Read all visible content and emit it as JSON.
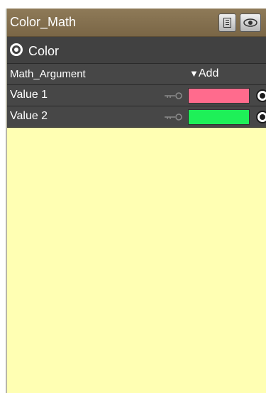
{
  "node": {
    "title": "Color_Math",
    "header_label": "Color",
    "argument": {
      "label": "Math_Argument",
      "dropdown_value": "Add"
    },
    "params": [
      {
        "label": "Value 1",
        "color": "#ff6b8d"
      },
      {
        "label": "Value 2",
        "color": "#1ef058"
      }
    ]
  },
  "colors": {
    "canvas": "#ffffb3",
    "titlebar": "#8e7a58",
    "row": "#474747"
  }
}
